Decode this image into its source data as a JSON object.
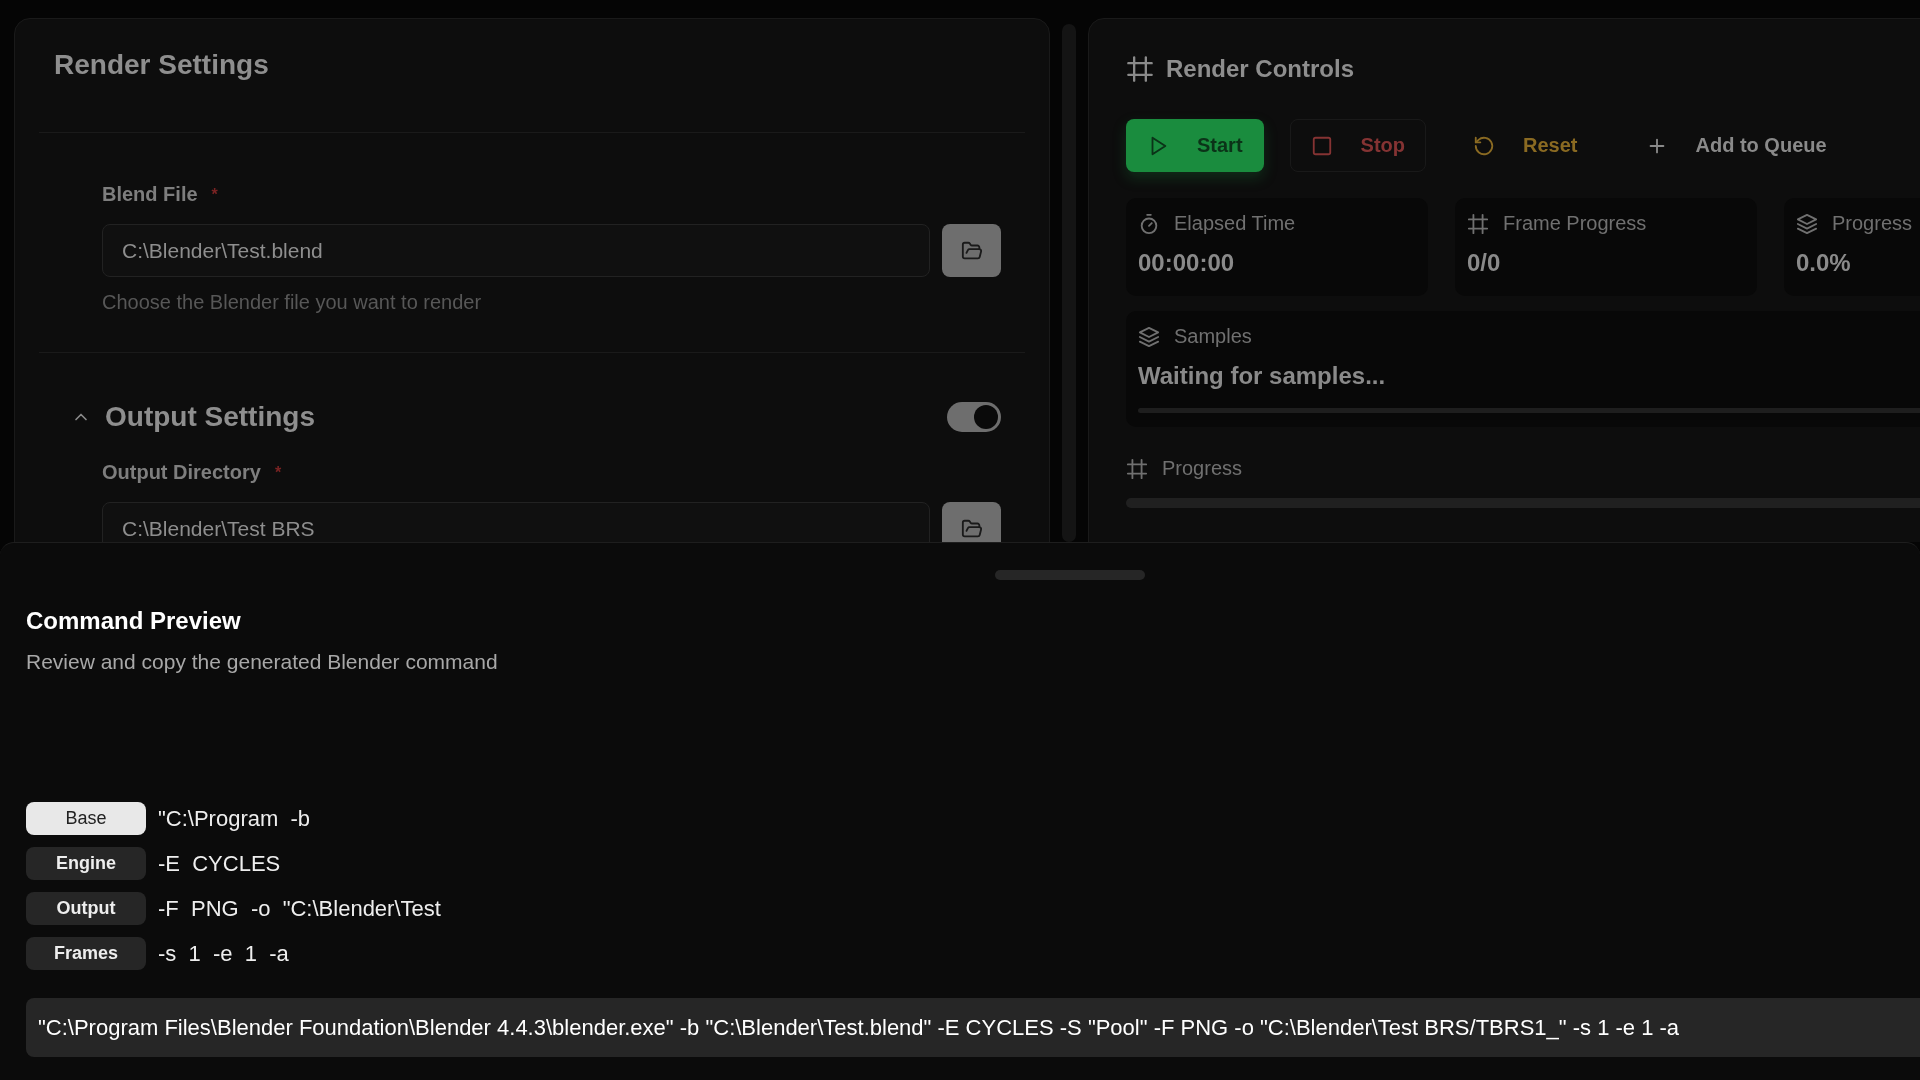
{
  "render_settings": {
    "title": "Render Settings",
    "blend_file": {
      "label": "Blend File",
      "required_mark": "*",
      "value": "C:\\Blender\\Test.blend",
      "hint": "Choose the Blender file you want to render"
    },
    "output_settings": {
      "title": "Output Settings",
      "expanded": true,
      "on": true,
      "output_directory": {
        "label": "Output Directory",
        "required_mark": "*",
        "value": "C:\\Blender\\Test BRS"
      }
    }
  },
  "render_controls": {
    "title": "Render Controls",
    "buttons": [
      {
        "label": "Start",
        "kind": "start",
        "disabled": false
      },
      {
        "label": "Stop",
        "kind": "stop",
        "disabled": true
      },
      {
        "label": "Reset",
        "kind": "reset",
        "disabled": false
      },
      {
        "label": "Add to Queue",
        "kind": "queue",
        "disabled": false
      }
    ],
    "stats": [
      {
        "kind": "time",
        "label": "Elapsed Time",
        "value": "00:00:00"
      },
      {
        "kind": "frames",
        "label": "Frame Progress",
        "value": "0/0"
      },
      {
        "kind": "layers",
        "label": "Progress",
        "value": "0.0%"
      }
    ],
    "samples": {
      "label": "Samples",
      "value": "Waiting for samples...",
      "level": 0
    },
    "progress": {
      "label": "Progress",
      "level": 0
    }
  },
  "command_preview": {
    "title": "Command Preview",
    "description": "Review and copy the generated Blender command",
    "parts": [
      {
        "label": "Base",
        "value": "\"C:\\Program  -b",
        "selected": true
      },
      {
        "label": "Engine",
        "value": "-E  CYCLES",
        "selected": false
      },
      {
        "label": "Output",
        "value": "-F  PNG  -o  \"C:\\Blender\\Test",
        "selected": false
      },
      {
        "label": "Frames",
        "value": "-s  1  -e  1  -a",
        "selected": false
      }
    ],
    "full_command": "\"C:\\Program Files\\Blender Foundation\\Blender 4.4.3\\blender.exe\" -b \"C:\\Blender\\Test.blend\" -E CYCLES -S \"Pool\" -F PNG -o \"C:\\Blender\\Test BRS/TBRS1_\" -s 1 -e 1 -a"
  }
}
